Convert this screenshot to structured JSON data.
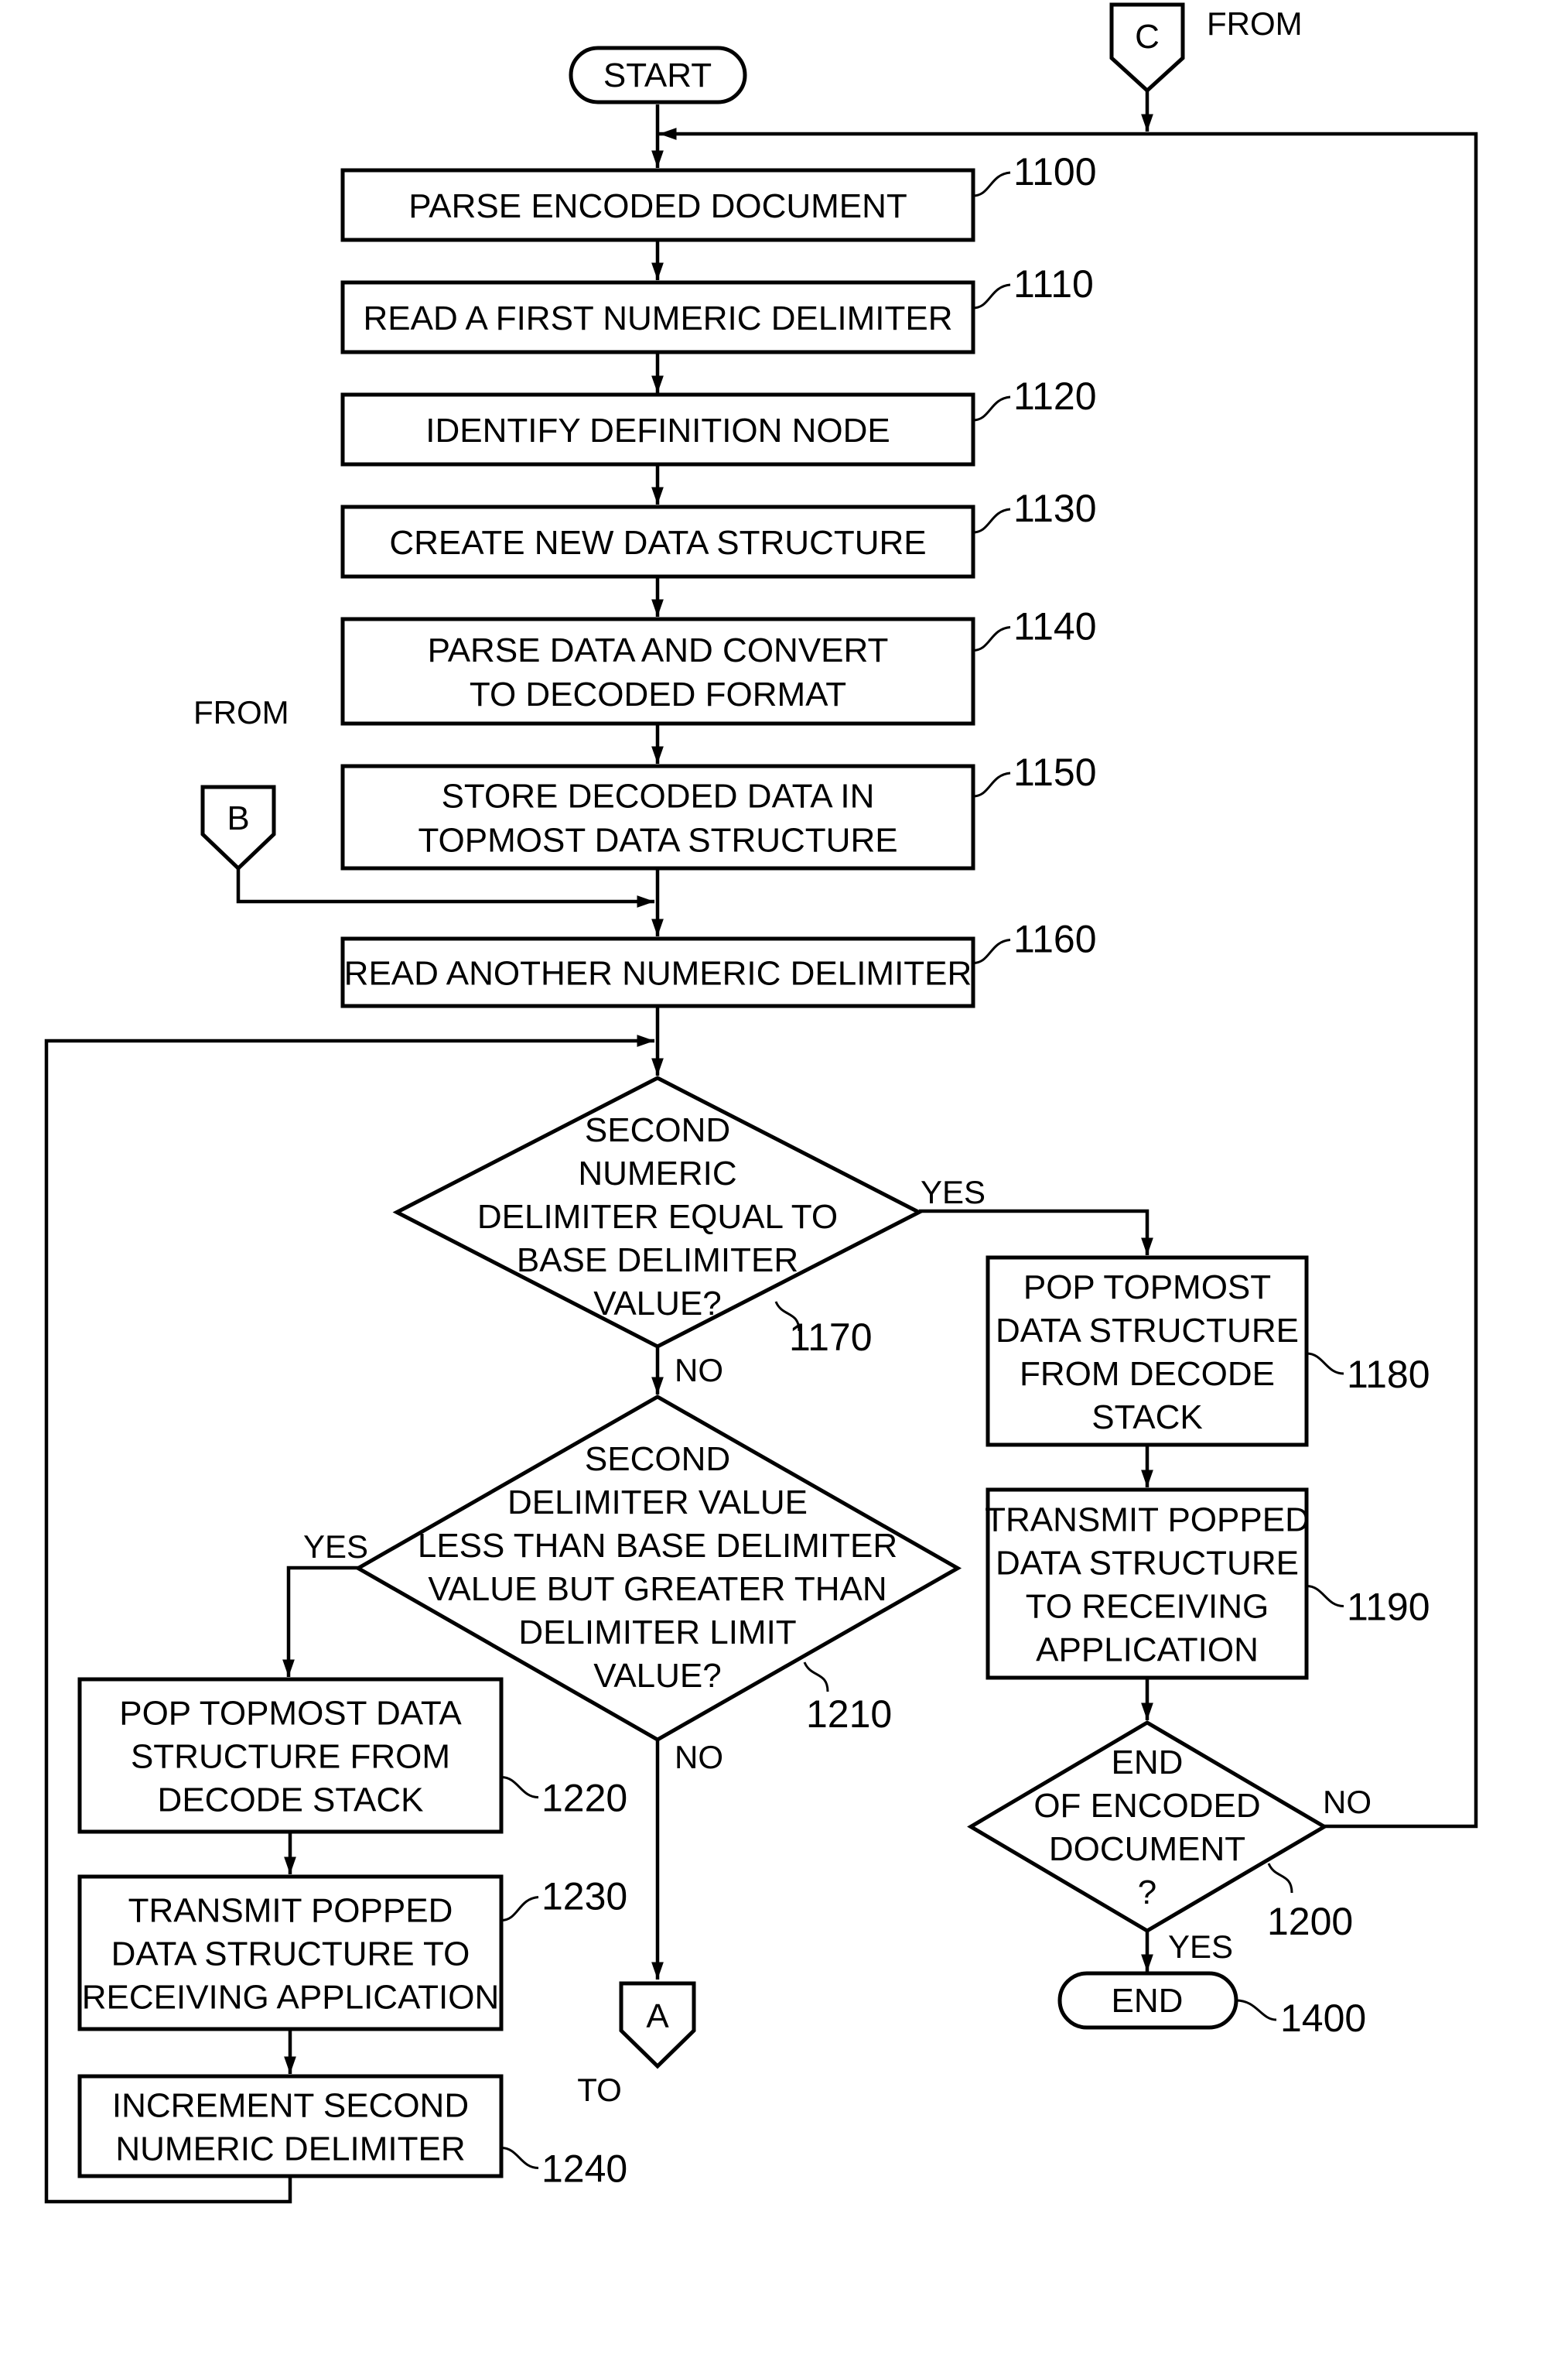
{
  "figure": {
    "terminals": {
      "start": "START",
      "end": "END"
    },
    "connectors": {
      "c": {
        "letter": "C",
        "caption": "FROM"
      },
      "b": {
        "letter": "B",
        "caption": "FROM"
      },
      "a": {
        "letter": "A",
        "caption": "TO"
      }
    },
    "steps": {
      "s1100": {
        "ref": "1100",
        "lines": [
          "PARSE ENCODED DOCUMENT"
        ]
      },
      "s1110": {
        "ref": "1110",
        "lines": [
          "READ A FIRST NUMERIC DELIMITER"
        ]
      },
      "s1120": {
        "ref": "1120",
        "lines": [
          "IDENTIFY DEFINITION NODE"
        ]
      },
      "s1130": {
        "ref": "1130",
        "lines": [
          "CREATE NEW DATA STRUCTURE"
        ]
      },
      "s1140": {
        "ref": "1140",
        "lines": [
          "PARSE DATA AND CONVERT",
          "TO DECODED FORMAT"
        ]
      },
      "s1150": {
        "ref": "1150",
        "lines": [
          "STORE DECODED DATA IN",
          "TOPMOST DATA STRUCTURE"
        ]
      },
      "s1160": {
        "ref": "1160",
        "lines": [
          "READ ANOTHER NUMERIC DELIMITER"
        ]
      },
      "s1180": {
        "ref": "1180",
        "lines": [
          "POP TOPMOST",
          "DATA STRUCTURE",
          "FROM DECODE",
          "STACK"
        ]
      },
      "s1190": {
        "ref": "1190",
        "lines": [
          "TRANSMIT POPPED",
          "DATA STRUCTURE",
          "TO RECEIVING",
          "APPLICATION"
        ]
      },
      "s1220": {
        "ref": "1220",
        "lines": [
          "POP TOPMOST DATA",
          "STRUCTURE FROM",
          "DECODE STACK"
        ]
      },
      "s1230": {
        "ref": "1230",
        "lines": [
          "TRANSMIT POPPED",
          "DATA STRUCTURE TO",
          "RECEIVING APPLICATION"
        ]
      },
      "s1240": {
        "ref": "1240",
        "lines": [
          "INCREMENT SECOND",
          "NUMERIC DELIMITER"
        ]
      }
    },
    "decisions": {
      "d1170": {
        "ref": "1170",
        "lines": [
          "SECOND",
          "NUMERIC",
          "DELIMITER EQUAL TO",
          "BASE DELIMITER",
          "VALUE?"
        ],
        "yes": "YES",
        "no": "NO"
      },
      "d1210": {
        "ref": "1210",
        "lines": [
          "SECOND",
          "DELIMITER VALUE",
          "LESS THAN BASE DELIMITER",
          "VALUE BUT GREATER THAN",
          "DELIMITER LIMIT",
          "VALUE?"
        ],
        "yes": "YES",
        "no": "NO"
      },
      "d1200": {
        "ref": "1200",
        "lines": [
          "END",
          "OF ENCODED",
          "DOCUMENT",
          "?"
        ],
        "yes": "YES",
        "no": "NO"
      }
    },
    "end_ref": "1400"
  }
}
